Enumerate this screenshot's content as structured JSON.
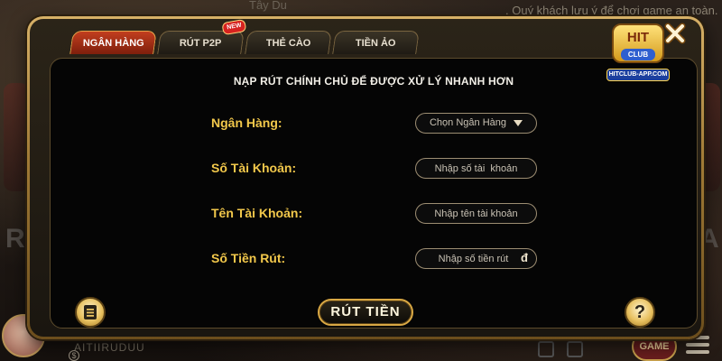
{
  "background": {
    "top_label": "Tây Du",
    "notice": ". Quý khách lưu ý để chơi game an toàn.",
    "left_letters": "RO",
    "right_letters": "A",
    "username": "AITIIRUDUU",
    "coin_symbol": "$",
    "game_button": "GAME"
  },
  "logo": {
    "brand": "HIT",
    "club": "CLUB",
    "site": "HITCLUB-APP.COM"
  },
  "tabs": [
    {
      "label": "NGÂN HÀNG",
      "active": true
    },
    {
      "label": "RÚT P2P",
      "active": false,
      "badge": "NEW"
    },
    {
      "label": "THẺ CÀO",
      "active": false
    },
    {
      "label": "TIỀN ẢO",
      "active": false
    }
  ],
  "panel": {
    "notice": "NẠP RÚT CHÍNH CHỦ ĐỂ ĐƯỢC XỬ LÝ NHANH HƠN",
    "fields": {
      "bank": {
        "label": "Ngân Hàng:",
        "value": "Chọn Ngân Hàng"
      },
      "account_number": {
        "label": "Số Tài Khoản:",
        "placeholder": "Nhập số tài  khoản"
      },
      "account_name": {
        "label": "Tên Tài Khoản:",
        "placeholder": "Nhập tên tài khoản"
      },
      "amount": {
        "label": "Số Tiền Rút:",
        "placeholder": "Nhập số tiền rút",
        "currency": "đ"
      }
    },
    "submit_label": "RÚT TIỀN",
    "help_symbol": "?"
  },
  "colors": {
    "accent_gold": "#f2c84b",
    "active_tab": "#c23e1f",
    "frame_gold": "#d6b067"
  }
}
